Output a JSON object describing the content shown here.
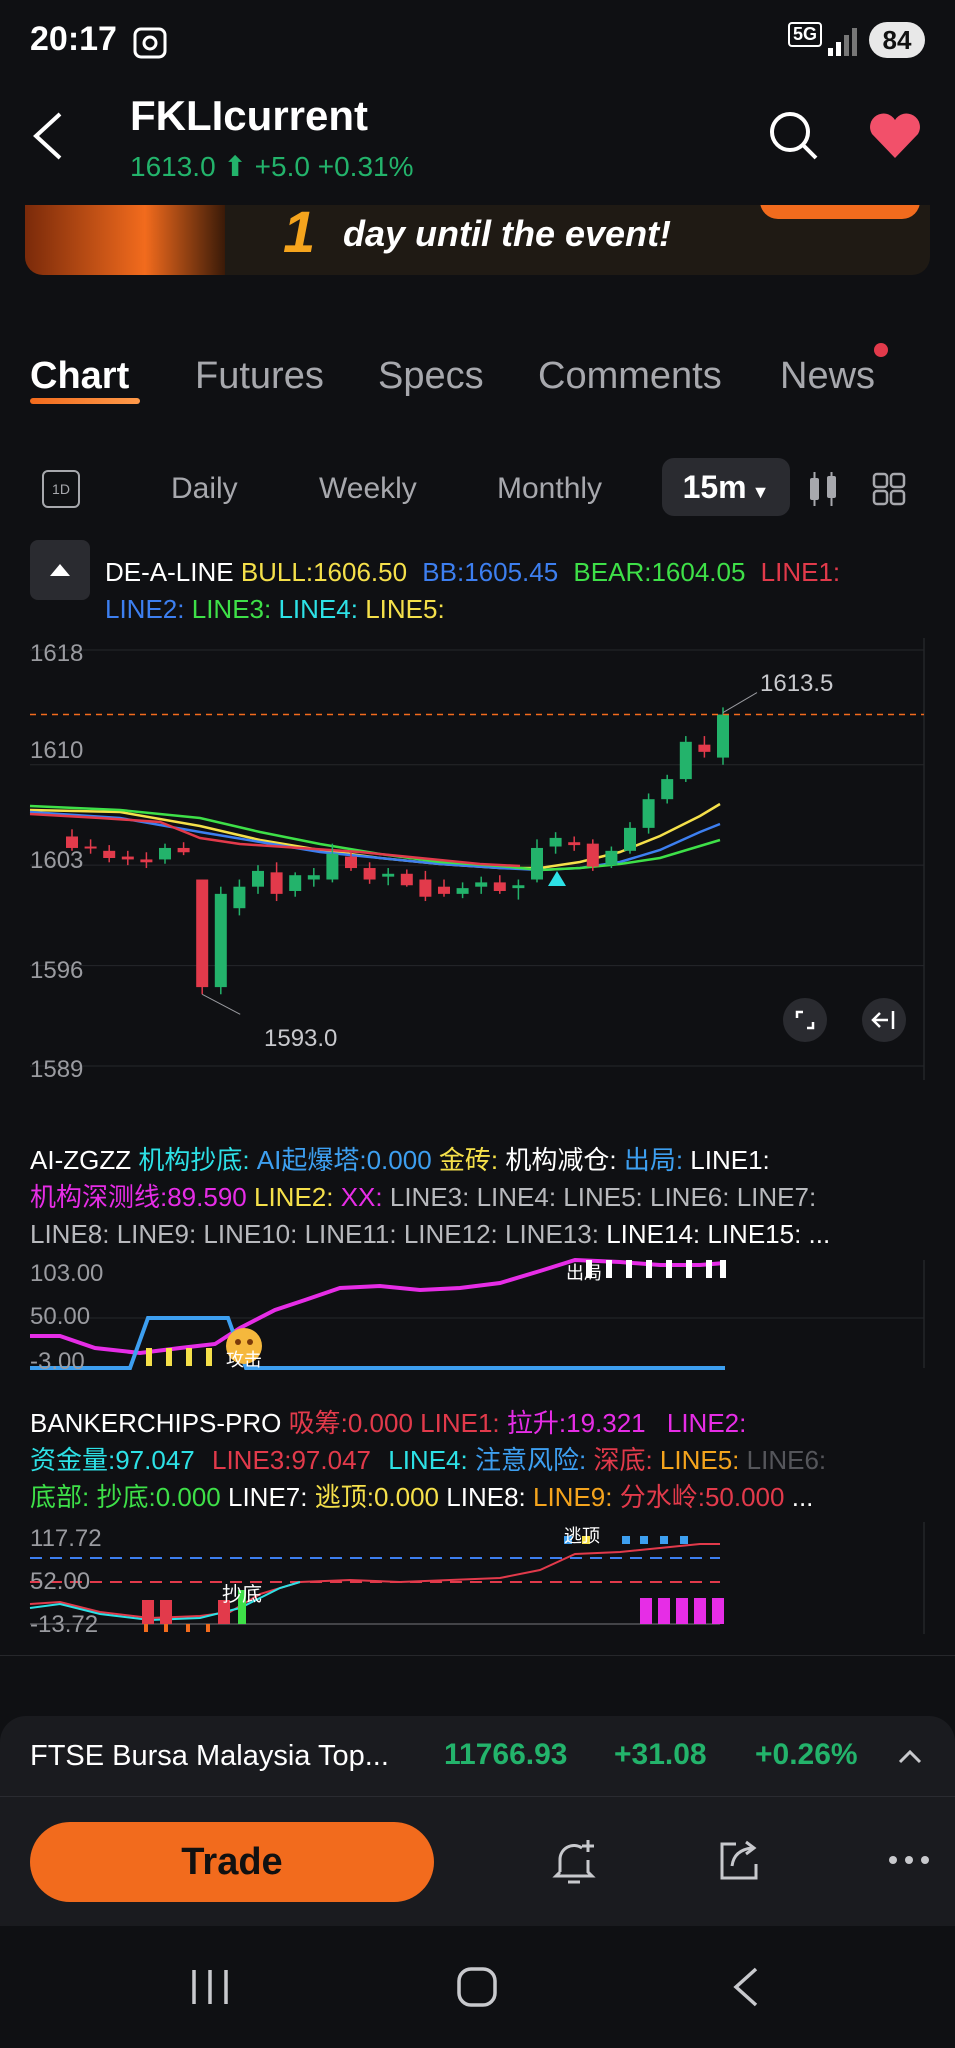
{
  "status_bar": {
    "time": "20:17",
    "network": "5G",
    "battery": "84"
  },
  "header": {
    "title": "FKLIcurrent",
    "price": "1613.0",
    "change": "+5.0",
    "change_pct": "+0.31%"
  },
  "banner": {
    "text": "day until the event!",
    "number": "1"
  },
  "tabs": [
    {
      "label": "Chart",
      "active": true
    },
    {
      "label": "Futures"
    },
    {
      "label": "Specs"
    },
    {
      "label": "Comments"
    },
    {
      "label": "News"
    }
  ],
  "timeframes": {
    "icon_1d": "1D",
    "daily": "Daily",
    "weekly": "Weekly",
    "monthly": "Monthly",
    "selected": "15m"
  },
  "main_indicator": {
    "name": "DE-A-LINE",
    "bull": "BULL:1606.50",
    "bb": "BB:1605.45",
    "bear": "BEAR:1604.05",
    "line1": "LINE1:",
    "line2": "LINE2:",
    "line3": "LINE3:",
    "line4": "LINE4:",
    "line5": "LINE5:"
  },
  "chart_data": {
    "type": "candlestick",
    "y_ticks": [
      "1618",
      "1610",
      "1603",
      "1596",
      "1589"
    ],
    "ylim": [
      1589,
      1618
    ],
    "last_price_label": "1613.5",
    "low_label": "1593.0",
    "candles": [
      {
        "o": 1605.0,
        "h": 1605.5,
        "l": 1604.0,
        "c": 1604.2
      },
      {
        "o": 1604.3,
        "h": 1604.8,
        "l": 1603.8,
        "c": 1604.2
      },
      {
        "o": 1604.0,
        "h": 1604.4,
        "l": 1603.2,
        "c": 1603.5
      },
      {
        "o": 1603.6,
        "h": 1604.0,
        "l": 1603.0,
        "c": 1603.4
      },
      {
        "o": 1603.4,
        "h": 1603.9,
        "l": 1602.8,
        "c": 1603.2
      },
      {
        "o": 1603.4,
        "h": 1604.5,
        "l": 1603.1,
        "c": 1604.2
      },
      {
        "o": 1604.2,
        "h": 1604.6,
        "l": 1603.7,
        "c": 1603.9
      },
      {
        "o": 1602.0,
        "h": 1602.0,
        "l": 1594.0,
        "c": 1594.5
      },
      {
        "o": 1594.5,
        "h": 1601.5,
        "l": 1594.0,
        "c": 1601.0
      },
      {
        "o": 1600.0,
        "h": 1602.0,
        "l": 1599.5,
        "c": 1601.5
      },
      {
        "o": 1601.5,
        "h": 1603.0,
        "l": 1601.0,
        "c": 1602.6
      },
      {
        "o": 1602.5,
        "h": 1603.2,
        "l": 1600.5,
        "c": 1601.0
      },
      {
        "o": 1601.2,
        "h": 1602.5,
        "l": 1600.8,
        "c": 1602.3
      },
      {
        "o": 1602.0,
        "h": 1602.8,
        "l": 1601.5,
        "c": 1602.3
      },
      {
        "o": 1602.0,
        "h": 1604.5,
        "l": 1601.8,
        "c": 1603.8
      },
      {
        "o": 1603.6,
        "h": 1604.0,
        "l": 1602.6,
        "c": 1602.8
      },
      {
        "o": 1602.8,
        "h": 1603.2,
        "l": 1601.7,
        "c": 1602.0
      },
      {
        "o": 1602.2,
        "h": 1602.8,
        "l": 1601.6,
        "c": 1602.4
      },
      {
        "o": 1602.4,
        "h": 1602.7,
        "l": 1601.5,
        "c": 1601.6
      },
      {
        "o": 1602.0,
        "h": 1602.6,
        "l": 1600.5,
        "c": 1600.8
      },
      {
        "o": 1601.5,
        "h": 1602.0,
        "l": 1600.8,
        "c": 1601.0
      },
      {
        "o": 1601.0,
        "h": 1601.8,
        "l": 1600.7,
        "c": 1601.4
      },
      {
        "o": 1601.5,
        "h": 1602.2,
        "l": 1601.0,
        "c": 1601.8
      },
      {
        "o": 1601.8,
        "h": 1602.3,
        "l": 1601.0,
        "c": 1601.2
      },
      {
        "o": 1601.4,
        "h": 1602.0,
        "l": 1600.6,
        "c": 1601.6
      },
      {
        "o": 1602.0,
        "h": 1604.8,
        "l": 1601.8,
        "c": 1604.2
      },
      {
        "o": 1604.3,
        "h": 1605.3,
        "l": 1603.8,
        "c": 1604.9
      },
      {
        "o": 1604.6,
        "h": 1605.0,
        "l": 1604.0,
        "c": 1604.4
      },
      {
        "o": 1604.5,
        "h": 1604.8,
        "l": 1602.6,
        "c": 1602.9
      },
      {
        "o": 1603.0,
        "h": 1604.3,
        "l": 1602.8,
        "c": 1604.0
      },
      {
        "o": 1604.0,
        "h": 1606.0,
        "l": 1603.8,
        "c": 1605.6
      },
      {
        "o": 1605.6,
        "h": 1608.0,
        "l": 1605.2,
        "c": 1607.6
      },
      {
        "o": 1607.6,
        "h": 1609.3,
        "l": 1607.3,
        "c": 1609.0
      },
      {
        "o": 1609.0,
        "h": 1612.0,
        "l": 1608.8,
        "c": 1611.6
      },
      {
        "o": 1611.4,
        "h": 1612.0,
        "l": 1610.5,
        "c": 1610.9
      },
      {
        "o": 1610.5,
        "h": 1614.0,
        "l": 1610.0,
        "c": 1613.5
      }
    ]
  },
  "zgzz": {
    "name": "AI-ZGZZ",
    "a": "机构抄底:",
    "b": "AI起爆塔:0.000",
    "c": "金砖:",
    "d": "机构减仓:",
    "e": "出局:",
    "f": "LINE1:",
    "g": "机构深测线:89.590",
    "h": "LINE2:",
    "i": "XX:",
    "j": "LINE3: LINE4: LINE5: LINE6: LINE7:",
    "k": "LINE8: LINE9: LINE10:  LINE11:   LINE12:  LINE13:",
    "l": "LINE14:  LINE15:  ...",
    "y_ticks": [
      "103.00",
      "50.00",
      "-3.00"
    ],
    "label_exit": "出局",
    "label_attack": "攻击"
  },
  "banker": {
    "name": "BANKERCHIPS-PRO",
    "a": "吸筹:0.000",
    "b": "LINE1:",
    "c": "拉升:19.321",
    "d": "LINE2:",
    "e": "资金量:97.047",
    "f": "LINE3:97.047",
    "g": "LINE4:",
    "h": "注意风险:",
    "i": "深底:",
    "j": "LINE5:",
    "k": "LINE6:",
    "l": "底部:",
    "m": "抄底:0.000",
    "n": "LINE7:",
    "o": "逃顶:0.000",
    "p": "LINE8:",
    "q": "LINE9:",
    "r": "分水岭:50.000",
    "s": "...",
    "y_ticks": [
      "117.72",
      "52.00",
      "-13.72"
    ],
    "label_top": "逃顶",
    "label_bottom": "抄底"
  },
  "ticker": {
    "name": "FTSE Bursa Malaysia Top...",
    "value": "11766.93",
    "change": "+31.08",
    "change_pct": "+0.26%"
  },
  "actions": {
    "trade": "Trade"
  },
  "colors": {
    "green": "#23b36b",
    "red": "#e23a4b",
    "orange": "#f26b1d",
    "yellow": "#f5e04a",
    "blue": "#3d7ff0",
    "magenta": "#e62de6",
    "cyan": "#2de1e6"
  }
}
